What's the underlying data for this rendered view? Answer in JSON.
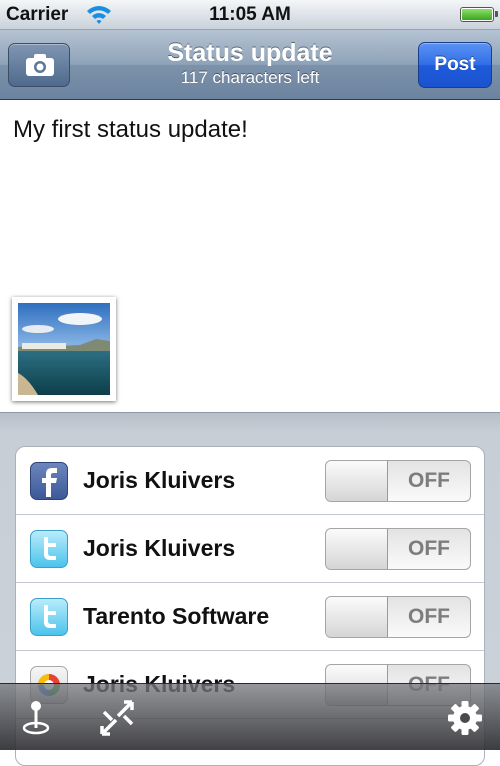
{
  "status_bar": {
    "carrier": "Carrier",
    "time": "11:05 AM",
    "icons": [
      "wifi-icon",
      "battery-icon"
    ]
  },
  "nav": {
    "title": "Status update",
    "subtitle": "117 characters left",
    "post_label": "Post",
    "left_icon": "camera-icon",
    "accent_color": "#2f6ee6"
  },
  "compose": {
    "text": "My first status update!",
    "attachment": "photo-thumbnail"
  },
  "accounts": [
    {
      "service": "facebook",
      "icon": "facebook-icon",
      "name": "Joris Kluivers",
      "toggle": "OFF"
    },
    {
      "service": "twitter",
      "icon": "twitter-icon",
      "name": "Joris Kluivers",
      "toggle": "OFF"
    },
    {
      "service": "twitter",
      "icon": "twitter-icon",
      "name": "Tarento Software",
      "toggle": "OFF"
    },
    {
      "service": "google",
      "icon": "google-buzz-icon",
      "name": "Joris Kluivers",
      "toggle": "OFF"
    }
  ],
  "toolbar": {
    "icons": [
      "location-pin-icon",
      "shorten-link-icon",
      "gear-icon"
    ]
  }
}
